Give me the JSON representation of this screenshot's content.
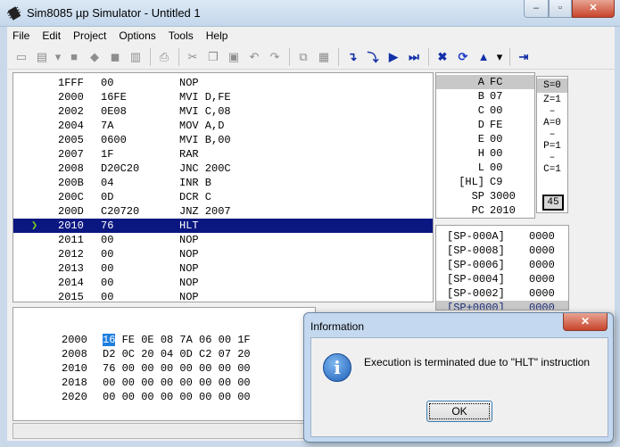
{
  "window": {
    "title": "Sim8085 µp Simulator - Untitled 1",
    "min_glyph": "–",
    "max_glyph": "▫",
    "close_glyph": "✕"
  },
  "menu": [
    "File",
    "Edit",
    "Project",
    "Options",
    "Tools",
    "Help"
  ],
  "toolbar_icons": [
    "new-icon",
    "open-icon",
    "dropdown-icon",
    "stop-icon",
    "copy-block-icon",
    "paste-block-icon",
    "build-icon",
    "print-icon",
    "cut-icon",
    "copy-icon",
    "paste-icon",
    "undo-icon",
    "redo-icon",
    "copy-memory-icon",
    "paste-memory-icon",
    "step-into-icon",
    "step-over-icon",
    "run-icon",
    "run-to-end-icon",
    "stop-run-icon",
    "reset-icon",
    "assemble-icon",
    "dropdown-icon",
    "exit-icon"
  ],
  "code": [
    {
      "addr": "1FFF",
      "hex": "00",
      "inst": "NOP"
    },
    {
      "addr": "2000",
      "hex": "16FE",
      "inst": "MVI D,FE"
    },
    {
      "addr": "2002",
      "hex": "0E08",
      "inst": "MVI C,08"
    },
    {
      "addr": "2004",
      "hex": "7A",
      "inst": "MOV A,D"
    },
    {
      "addr": "2005",
      "hex": "0600",
      "inst": "MVI B,00"
    },
    {
      "addr": "2007",
      "hex": "1F",
      "inst": "RAR"
    },
    {
      "addr": "2008",
      "hex": "D20C20",
      "inst": "JNC 200C"
    },
    {
      "addr": "200B",
      "hex": "04",
      "inst": "INR B"
    },
    {
      "addr": "200C",
      "hex": "0D",
      "inst": "DCR C"
    },
    {
      "addr": "200D",
      "hex": "C20720",
      "inst": "JNZ 2007"
    },
    {
      "addr": "2010",
      "hex": "76",
      "inst": "HLT"
    },
    {
      "addr": "2011",
      "hex": "00",
      "inst": "NOP"
    },
    {
      "addr": "2012",
      "hex": "00",
      "inst": "NOP"
    },
    {
      "addr": "2013",
      "hex": "00",
      "inst": "NOP"
    },
    {
      "addr": "2014",
      "hex": "00",
      "inst": "NOP"
    },
    {
      "addr": "2015",
      "hex": "00",
      "inst": "NOP"
    }
  ],
  "current_line_arrow": "❯",
  "registers": [
    {
      "name": "A",
      "value": "FC"
    },
    {
      "name": "B",
      "value": "07"
    },
    {
      "name": "C",
      "value": "00"
    },
    {
      "name": "D",
      "value": "FE"
    },
    {
      "name": "E",
      "value": "00"
    },
    {
      "name": "H",
      "value": "00"
    },
    {
      "name": "L",
      "value": "00"
    },
    {
      "name": "[HL]",
      "value": "C9"
    },
    {
      "name": "SP",
      "value": "3000"
    },
    {
      "name": "PC",
      "value": "2010"
    }
  ],
  "flags": [
    "S=0",
    "Z=1",
    "A=0",
    "P=1",
    "C=1"
  ],
  "flag_sep": "–",
  "flag_box": "45",
  "stack": [
    {
      "label": "[SP-000A]",
      "value": "0000"
    },
    {
      "label": "[SP-0008]",
      "value": "0000"
    },
    {
      "label": "[SP-0006]",
      "value": "0000"
    },
    {
      "label": "[SP-0004]",
      "value": "0000"
    },
    {
      "label": "[SP-0002]",
      "value": "0000"
    },
    {
      "label": "[SP+0000]",
      "value": "0000"
    }
  ],
  "memory": [
    {
      "addr": "2000",
      "first": "16",
      "rest": "FE 0E 08 7A 06 00 1F"
    },
    {
      "addr": "2008",
      "first": "D2",
      "rest": "0C 20 04 0D C2 07 20"
    },
    {
      "addr": "2010",
      "first": "76",
      "rest": "00 00 00 00 00 00 00"
    },
    {
      "addr": "2018",
      "first": "00",
      "rest": "00 00 00 00 00 00 00"
    },
    {
      "addr": "2020",
      "first": "00",
      "rest": "00 00 00 00 00 00 00"
    }
  ],
  "dialog": {
    "title": "Information",
    "close_glyph": "✕",
    "icon": "i",
    "message": "Execution is terminated due to \"HLT\" instruction",
    "ok_label": "OK"
  }
}
